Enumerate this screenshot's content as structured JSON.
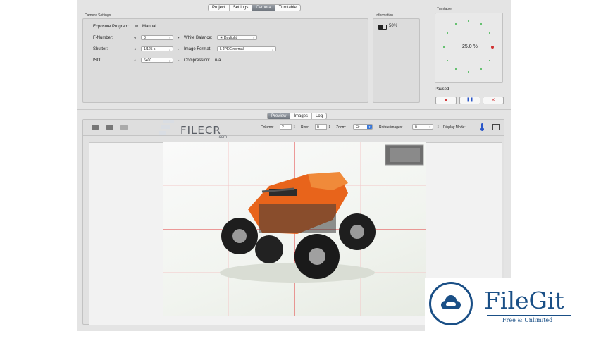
{
  "top_tabs": [
    "Project",
    "Settings",
    "Camera",
    "Turntable"
  ],
  "top_tabs_active": 2,
  "camera_settings": {
    "title": "Camera Settings",
    "exposure_label": "Exposure Program:",
    "exposure_value": "Manual",
    "fnumber_label": "F-Number:",
    "fnumber_value": "8",
    "shutter_label": "Shutter:",
    "shutter_value": "1/125 s",
    "iso_label": "ISO:",
    "iso_value": "6400",
    "wb_label": "White Balance:",
    "wb_value": "Daylight",
    "format_label": "Image Format:",
    "format_value": "L JPEG normal",
    "compression_label": "Compression:",
    "compression_value": "n/a"
  },
  "information": {
    "title": "Information",
    "battery": "50%"
  },
  "turntable": {
    "title": "Turntable",
    "percent": "25.0 %",
    "status": "Paused",
    "buttons": {
      "record": "●",
      "pause": "❚❚",
      "stop": "✕"
    }
  },
  "bottom_tabs": [
    "Preview",
    "Images",
    "Log"
  ],
  "bottom_tabs_active": 0,
  "toolbar": {
    "column_label": "Column:",
    "column_value": "2",
    "row_label": "Row:",
    "row_value": "0",
    "zoom_label": "Zoom:",
    "zoom_value": "Fit",
    "rotate_label": "Rotate images:",
    "rotate_value": "0",
    "display_mode_label": "Display Mode:"
  },
  "watermarks": {
    "filecr": "FILECR",
    "filecr_sub": ".com",
    "filegit_title": "FileGit",
    "filegit_sub": "Free & Unlimited"
  },
  "colors": {
    "window_bg": "#e4e4e4",
    "accent": "#1a4f86",
    "grid_line": "#e23b3b",
    "orange": "#e8641b"
  }
}
